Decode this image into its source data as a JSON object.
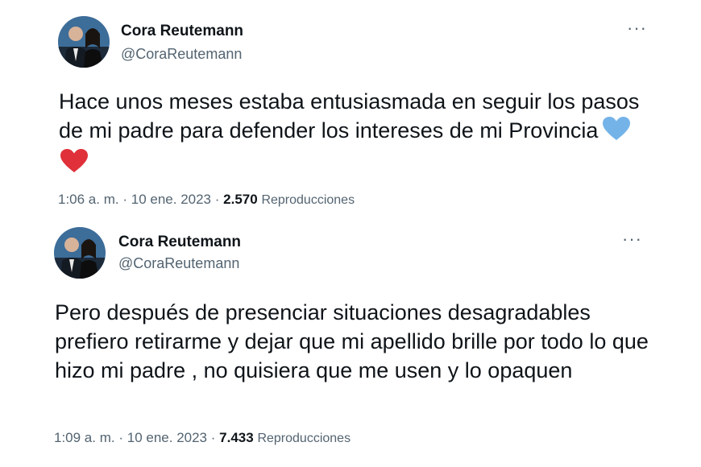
{
  "tweets": [
    {
      "author_name": "Cora Reutemann",
      "handle": "@CoraReutemann",
      "text": "Hace unos meses estaba entusiasmada en seguir los pasos de mi padre para defender los intereses de mi Provincia",
      "emojis": [
        "light-blue-heart-icon",
        "red-heart-icon"
      ],
      "time": "1:06 a. m.",
      "separator": "·",
      "date": "10 ene. 2023",
      "views": "2.570",
      "views_label": "Reproducciones",
      "more_label": "···"
    },
    {
      "author_name": "Cora Reutemann",
      "handle": "@CoraReutemann",
      "text": "Pero después de presenciar situaciones desagradables prefiero retirarme y dejar que mi apellido brille por todo lo que hizo mi padre , no quisiera que me usen y lo opaquen",
      "time": "1:09 a. m.",
      "separator": "·",
      "date": "10 ene. 2023",
      "views": "7.433",
      "views_label": "Reproducciones",
      "more_label": "···"
    }
  ],
  "colors": {
    "text": "#0f1419",
    "secondary": "#536471",
    "heart_blue": "#74b3e8",
    "heart_red": "#e0303a"
  }
}
